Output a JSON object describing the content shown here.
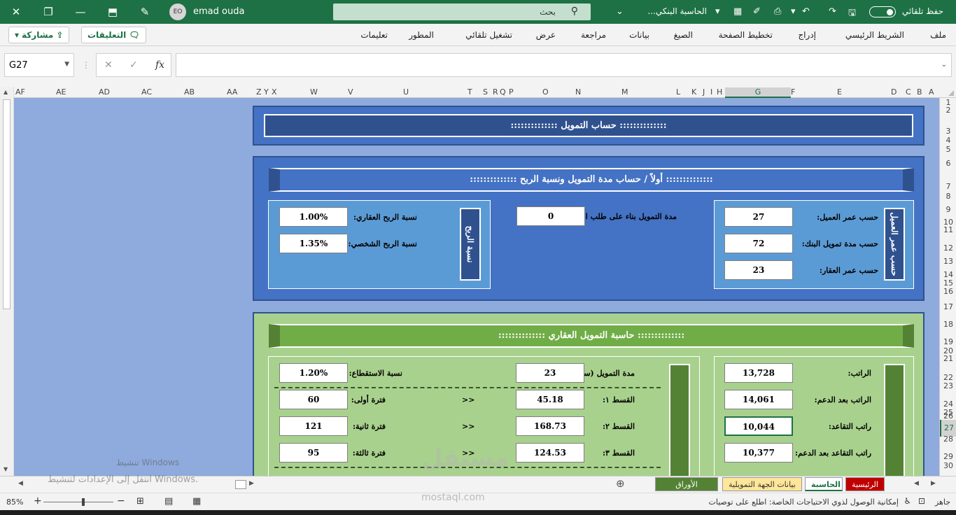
{
  "titlebar": {
    "close_icon": "close-icon",
    "user_initials": "EO",
    "user_name": "emad ouda",
    "search_placeholder": "بحث",
    "doc_title": "الحاسبة البنكي...",
    "autosave_label": "حفظ تلقائي"
  },
  "ribbon": {
    "tabs": [
      "ملف",
      "الشريط الرئيسي",
      "إدراج",
      "تخطيط الصفحة",
      "الصيغ",
      "بيانات",
      "مراجعة",
      "عرض",
      "تشغيل تلقائي",
      "المطور",
      "تعليمات"
    ],
    "comments_label": "التعليقات",
    "share_label": "مشاركة"
  },
  "formula_bar": {
    "name_box": "G27",
    "fx_label": "fx",
    "formula": ""
  },
  "columns": [
    "AF",
    "AE",
    "AD",
    "AC",
    "AB",
    "AA",
    "Z",
    "Y",
    "X",
    "W",
    "V",
    "U",
    "T",
    "S",
    "R",
    "Q",
    "P",
    "O",
    "N",
    "M",
    "L",
    "K",
    "J",
    "I",
    "H",
    "G",
    "F",
    "E",
    "D",
    "C",
    "B",
    "A"
  ],
  "rows": [
    "1",
    "2",
    "3",
    "4",
    "5",
    "6",
    "7",
    "8",
    "9",
    "10",
    "11",
    "12",
    "13",
    "14",
    "15",
    "16",
    "17",
    "18",
    "19",
    "20",
    "21",
    "22",
    "23",
    "24",
    "25",
    "26",
    "27",
    "28",
    "29",
    "30"
  ],
  "calc": {
    "title": "::::::::::::::  حساب التمويل  ::::::::::::::",
    "section1_title": "::::::::::::::  أولاً / حساب مدة التمويل ونسبة الربح  ::::::::::::::",
    "age_bar": "حسب عمر العميل",
    "age_client_label": "حسب عمر العميل:",
    "age_client_value": "27",
    "bank_term_label": "حسب مدة تمويل البنك:",
    "bank_term_value": "72",
    "property_age_label": "حسب عمر العقار:",
    "property_age_value": "23",
    "client_request_label": "مدة التمويل بناء على طلب العميل:",
    "client_request_value": "0",
    "profit_bar": "نسبة الربح",
    "re_profit_label": "نسبة الربح العقاري:",
    "re_profit_value": "1.00%",
    "personal_profit_label": "نسبة الربح الشخصي:",
    "personal_profit_value": "1.35%",
    "section2_title": "::::::::::::::  حاسبة التمويل العقاري  ::::::::::::::",
    "salary_label": "الراتب:",
    "salary_value": "13,728",
    "salary_support_label": "الراتب بعد الدعم:",
    "salary_support_value": "14,061",
    "retire_label": "راتب التقاعد:",
    "retire_value": "10,044",
    "retire_support_label": "راتب التقاعد بعد الدعم:",
    "retire_support_value": "10,377",
    "term_label": "مدة التمويل (سنة):",
    "term_value": "23",
    "inst1_label": "القسط ١:",
    "inst1_value": "45.18",
    "inst2_label": "القسط ٢:",
    "inst2_value": "168.73",
    "inst3_label": "القسط ٣:",
    "inst3_value": "124.53",
    "deduction_label": "نسبة الاستقطاع:",
    "deduction_value": "1.20%",
    "period1_label": "فترة أولى:",
    "period1_value": "60",
    "period2_label": "فترة ثانية:",
    "period2_value": "121",
    "period3_label": "فترة ثالثة:",
    "period3_value": "95",
    "arrow": ">>"
  },
  "sheet_tabs": [
    {
      "label": "الرئيسية",
      "color": "#c00000"
    },
    {
      "label": "الحاسبة",
      "color": "#ffffff"
    },
    {
      "label": "بيانات الجهة التمويلية",
      "color": "#ffe699"
    },
    {
      "label": "الأوراق المطلوبة",
      "color": "#548235"
    }
  ],
  "status": {
    "ready": "جاهز",
    "accessibility": "إمكانية الوصول لذوي الاحتياجات الخاصة: اطلع على توصيات",
    "zoom": "85%"
  },
  "watermark": {
    "activate_line1": "تنشيط Windows",
    "activate_line2": "انتقل إلى الإعدادات لتنشيط Windows.",
    "brand_ar": "مستقل",
    "brand_url": "mostaql.com"
  },
  "colors": {
    "excel_green": "#1e7145",
    "sheet_bg": "#8faadc",
    "blue_section": "#4472c4",
    "green_section": "#70ad47"
  }
}
